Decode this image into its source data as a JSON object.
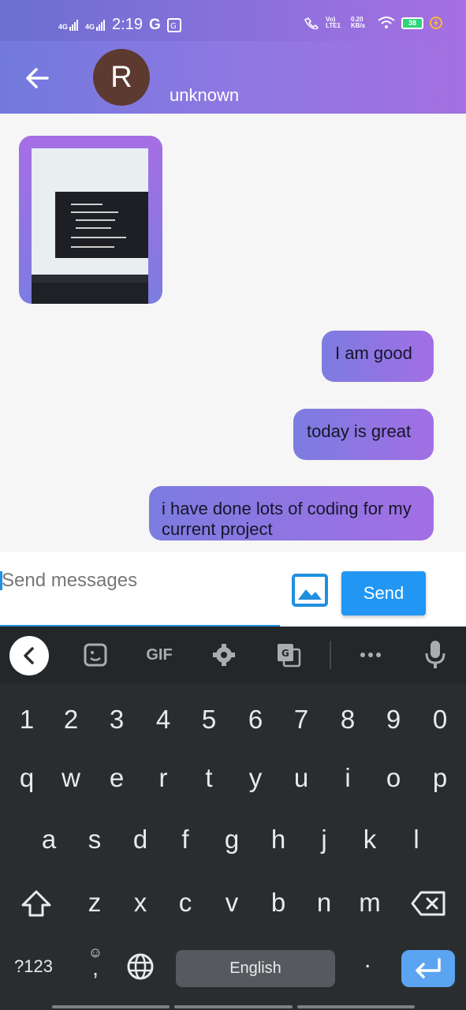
{
  "status_bar": {
    "net1": "4G",
    "net2": "4G",
    "time": "2:19",
    "g": "G",
    "volte": "Vo) LTE1",
    "speed": "0.20 KB/s",
    "battery": "38"
  },
  "header": {
    "avatar_letter": "R",
    "username": "unknown"
  },
  "messages": [
    {
      "text": "I am good"
    },
    {
      "text": "today is great"
    },
    {
      "text": "i have done lots of coding for my current project"
    }
  ],
  "composer": {
    "placeholder": "Send messages",
    "send_label": "Send"
  },
  "keyboard": {
    "gif_label": "GIF",
    "row_numbers": [
      "1",
      "2",
      "3",
      "4",
      "5",
      "6",
      "7",
      "8",
      "9",
      "0"
    ],
    "row_top": [
      "q",
      "w",
      "e",
      "r",
      "t",
      "y",
      "u",
      "i",
      "o",
      "p"
    ],
    "row_mid": [
      "a",
      "s",
      "d",
      "f",
      "g",
      "h",
      "j",
      "k",
      "l"
    ],
    "row_bottom": [
      "z",
      "x",
      "c",
      "v",
      "b",
      "n",
      "m"
    ],
    "symbols_label": "?123",
    "comma": ",",
    "space_label": "English",
    "period": "."
  }
}
